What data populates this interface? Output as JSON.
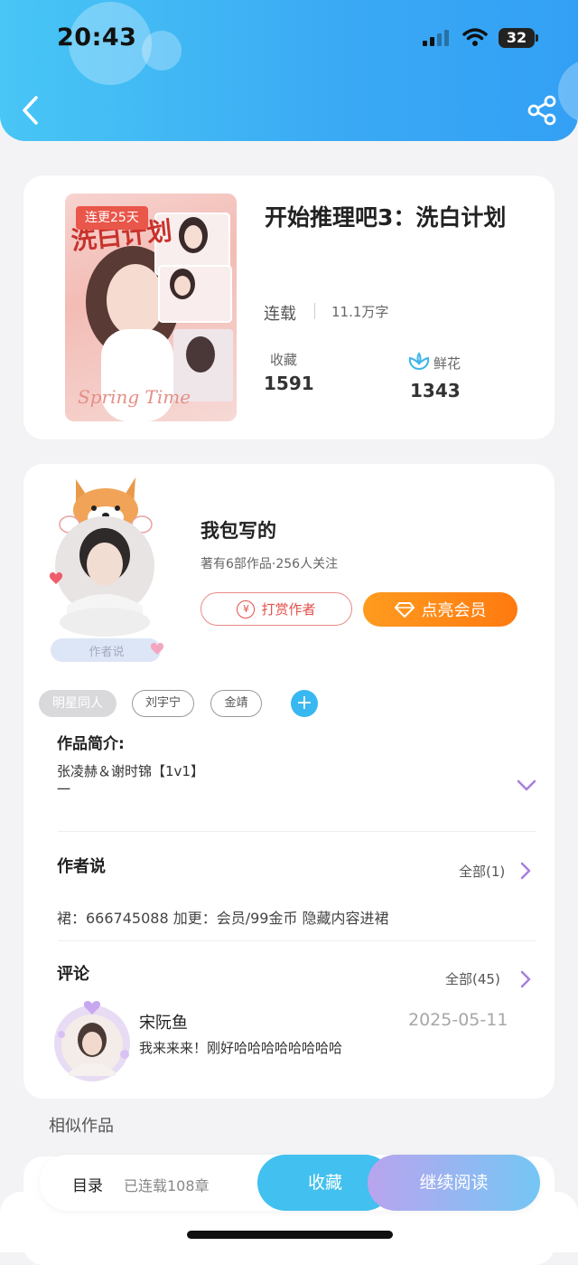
{
  "status_bar": {
    "time": "20:43",
    "battery": "32"
  },
  "book": {
    "title": "开始推理吧3：洗白计划",
    "cover_badge": "连更25天",
    "status": "连载",
    "word_count": "11.1万字",
    "favorites_label": "收藏",
    "favorites_value": "1591",
    "flowers_label": "鲜花",
    "flowers_value": "1343"
  },
  "author": {
    "name": "我包写的",
    "meta": "著有6部作品·256人关注",
    "avatar_caption": "作者说",
    "reward_button": "打赏作者",
    "reward_icon_char": "¥",
    "vip_button": "点亮会员"
  },
  "tags": [
    "明星同人",
    "刘宇宁",
    "金靖"
  ],
  "add_tag": "+",
  "synopsis": {
    "title": "作品简介:",
    "line1": "张凌赫＆谢时锦【1v1】",
    "line2": "一"
  },
  "author_note": {
    "title": "作者说",
    "all_label": "全部(1)",
    "content": "裙：666745088 加更：会员/99金币 隐藏内容进裙"
  },
  "comments": {
    "title": "评论",
    "all_label": "全部(45)",
    "items": [
      {
        "user": "宋阮鱼",
        "date": "2025-05-11",
        "text": "我来来来！刚好哈哈哈哈哈哈哈哈"
      }
    ]
  },
  "similar_title": "相似作品",
  "bottom_bar": {
    "catalog": "目录",
    "chapters": "已连载108章",
    "favorite_button": "收藏",
    "continue_button": "继续阅读"
  },
  "colors": {
    "header_blue": "#3aa9f4",
    "vip_orange": "#ff8a15",
    "reward_red": "#e0504b",
    "accent_purple": "#a77ee0"
  }
}
